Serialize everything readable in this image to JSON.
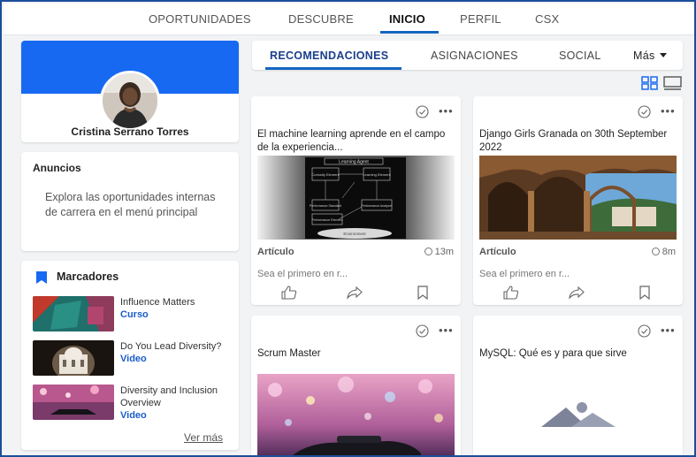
{
  "topnav": {
    "items": [
      "OPORTUNIDADES",
      "DESCUBRE",
      "INICIO",
      "PERFIL",
      "CSX"
    ],
    "active": "INICIO"
  },
  "profile": {
    "name": "Cristina Serrano Torres"
  },
  "announcements": {
    "title": "Anuncios",
    "text": "Explora las oportunidades internas de carrera en el menú principal"
  },
  "bookmarks": {
    "title": "Marcadores",
    "items": [
      {
        "title": "Influence Matters",
        "type": "Curso"
      },
      {
        "title": "Do You Lead Diversity?",
        "type": "Video"
      },
      {
        "title": "Diversity and Inclusion Overview",
        "type": "Video"
      }
    ],
    "see_more": "Ver más"
  },
  "tabs": {
    "items": [
      "RECOMENDACIONES",
      "ASIGNACIONES",
      "SOCIAL"
    ],
    "more": "Más",
    "active": "RECOMENDACIONES"
  },
  "feed": [
    {
      "title": "El machine learning aprende en el campo de la experiencia...",
      "type": "Artículo",
      "time": "13m",
      "first": "Sea el primero en r...",
      "image": "learning-agent-diagram"
    },
    {
      "title": "Django Girls Granada on 30th September 2022",
      "type": "Artículo",
      "time": "8m",
      "first": "Sea el primero en r...",
      "image": "alhambra-arches"
    },
    {
      "title": "Scrum Master",
      "image": "car-bokeh"
    },
    {
      "title": "MySQL: Qué es y para que sirve",
      "image": "placeholder-mountains"
    }
  ],
  "diagram_labels": {
    "top": "Learning Agent",
    "bottom": "Environment",
    "boxes": [
      "Curiosity Element",
      "Learning Element",
      "Performance Standard",
      "Performance Element",
      "Performance Analyzer"
    ]
  },
  "colors": {
    "accent": "#1565c0",
    "banner": "#1769f2",
    "frame": "#1b4e9b",
    "link_type": "#1a5dc9"
  }
}
